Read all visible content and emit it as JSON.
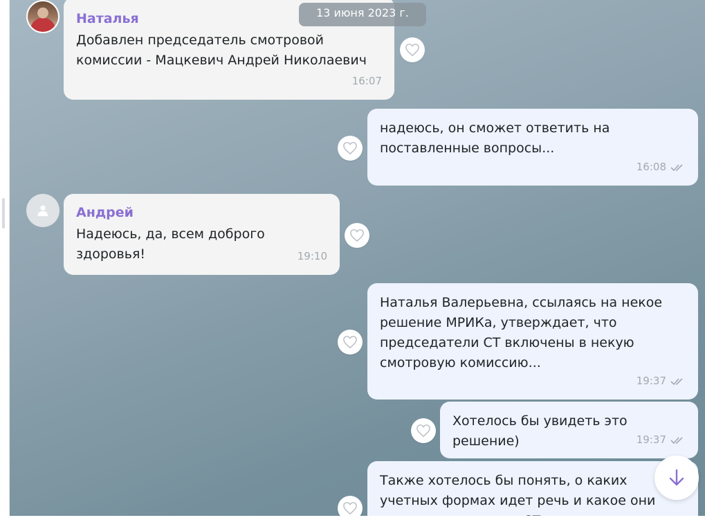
{
  "date_separator": "13 июня 2023 г.",
  "messages": [
    {
      "sender": "Наталья",
      "text": "Добавлен председатель смотровой комиссии - Мацкевич Андрей Николаевич",
      "time": "16:07",
      "direction": "in",
      "avatar": "natalya-photo-avatar"
    },
    {
      "text": "надеюсь, он сможет ответить на поставленные вопросы...",
      "time": "16:08",
      "direction": "out",
      "status": "read-double-check"
    },
    {
      "sender": "Андрей",
      "text": "Надеюсь, да, всем доброго здоровья!",
      "time": "19:10",
      "direction": "in",
      "avatar": "default-user-avatar"
    },
    {
      "text": "Наталья Валерьевна, ссылаясь на некое решение МРИКа, утверждает, что председатели СТ включены в некую смотровую комиссию...",
      "time": "19:37",
      "direction": "out",
      "status": "read-double-check"
    },
    {
      "text": "Хотелось бы увидеть это решение)",
      "time": "19:37",
      "direction": "out",
      "status": "read-double-check"
    },
    {
      "text": "Также хотелось бы понять, о каких учетных формах идет речь и какое они отношение имеют к СТ",
      "direction": "out"
    }
  ],
  "colors": {
    "sender_name": "#8a6fd3",
    "incoming_bubble": "#f4f4f4",
    "outgoing_bubble": "#eef3fe",
    "accent": "#8a6fd3",
    "time_text": "#a3a9ae"
  },
  "icons": {
    "reaction": "heart-outline-icon",
    "read_status": "double-check-icon",
    "scroll_down": "arrow-down-icon"
  }
}
